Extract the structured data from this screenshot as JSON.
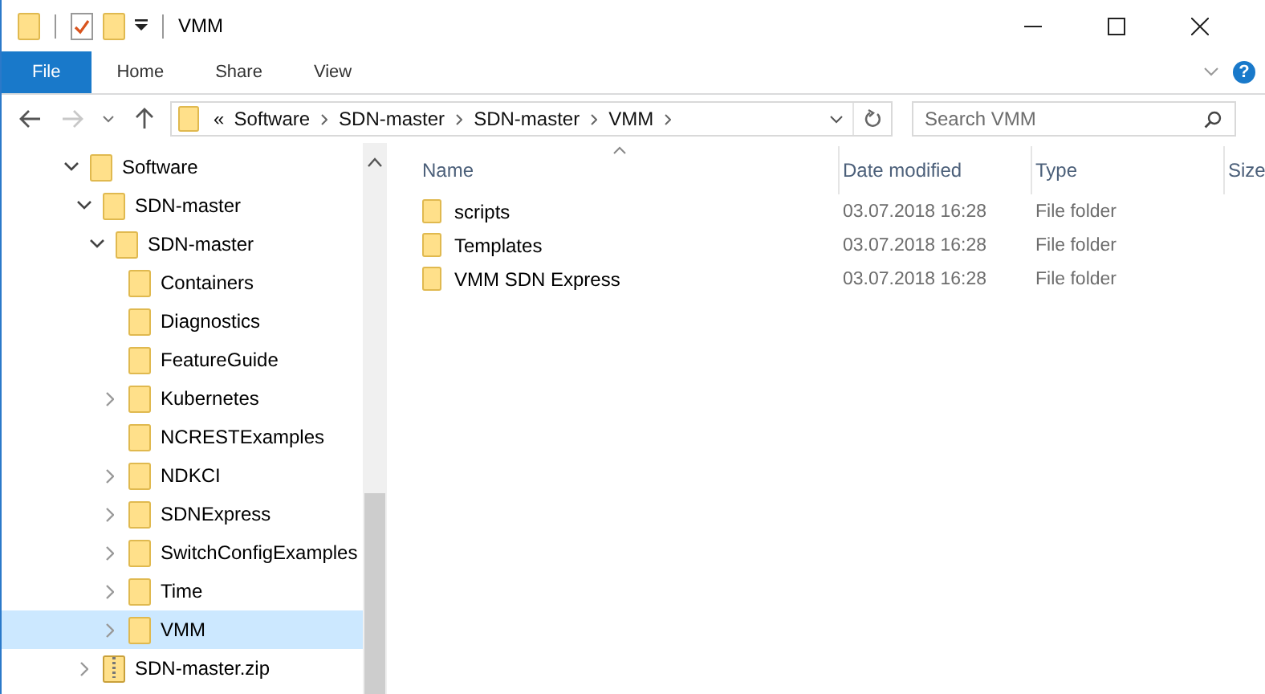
{
  "window": {
    "title": "VMM"
  },
  "ribbon": {
    "tabs": [
      {
        "label": "File",
        "selected": true
      },
      {
        "label": "Home",
        "selected": false
      },
      {
        "label": "Share",
        "selected": false
      },
      {
        "label": "View",
        "selected": false
      }
    ],
    "help_glyph": "?"
  },
  "navigation": {
    "back_disabled": false,
    "forward_disabled": true
  },
  "address": {
    "overflow_glyph": "«",
    "breadcrumbs": [
      "Software",
      "SDN-master",
      "SDN-master",
      "VMM"
    ]
  },
  "search": {
    "placeholder": "Search VMM"
  },
  "tree": [
    {
      "label": "Software",
      "kind": "folder",
      "expandable": true,
      "expanded": true,
      "selected": false,
      "children": [
        {
          "label": "SDN-master",
          "kind": "folder",
          "expandable": true,
          "expanded": true,
          "selected": false,
          "children": [
            {
              "label": "SDN-master",
              "kind": "folder",
              "expandable": true,
              "expanded": true,
              "selected": false,
              "children": [
                {
                  "label": "Containers",
                  "kind": "folder",
                  "expandable": false,
                  "expanded": false,
                  "selected": false
                },
                {
                  "label": "Diagnostics",
                  "kind": "folder",
                  "expandable": false,
                  "expanded": false,
                  "selected": false
                },
                {
                  "label": "FeatureGuide",
                  "kind": "folder",
                  "expandable": false,
                  "expanded": false,
                  "selected": false
                },
                {
                  "label": "Kubernetes",
                  "kind": "folder",
                  "expandable": true,
                  "expanded": false,
                  "selected": false
                },
                {
                  "label": "NCRESTExamples",
                  "kind": "folder",
                  "expandable": false,
                  "expanded": false,
                  "selected": false
                },
                {
                  "label": "NDKCI",
                  "kind": "folder",
                  "expandable": true,
                  "expanded": false,
                  "selected": false
                },
                {
                  "label": "SDNExpress",
                  "kind": "folder",
                  "expandable": true,
                  "expanded": false,
                  "selected": false
                },
                {
                  "label": "SwitchConfigExamples",
                  "kind": "folder",
                  "expandable": true,
                  "expanded": false,
                  "selected": false
                },
                {
                  "label": "Time",
                  "kind": "folder",
                  "expandable": true,
                  "expanded": false,
                  "selected": false
                },
                {
                  "label": "VMM",
                  "kind": "folder",
                  "expandable": true,
                  "expanded": false,
                  "selected": true
                }
              ]
            }
          ]
        },
        {
          "label": "SDN-master.zip",
          "kind": "zip",
          "expandable": true,
          "expanded": false,
          "selected": false
        }
      ]
    }
  ],
  "files": {
    "columns": [
      {
        "label": "Name",
        "sorted": true
      },
      {
        "label": "Date modified",
        "sorted": false
      },
      {
        "label": "Type",
        "sorted": false
      },
      {
        "label": "Size",
        "sorted": false
      }
    ],
    "rows": [
      {
        "name": "scripts",
        "date": "03.07.2018 16:28",
        "type": "File folder"
      },
      {
        "name": "Templates",
        "date": "03.07.2018 16:28",
        "type": "File folder"
      },
      {
        "name": "VMM SDN Express",
        "date": "03.07.2018 16:28",
        "type": "File folder"
      }
    ]
  }
}
